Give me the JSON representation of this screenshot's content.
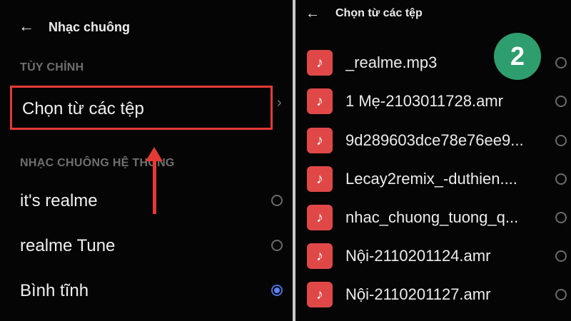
{
  "left": {
    "header": {
      "title": "Nhạc chuông"
    },
    "custom_section": "TÙY CHỈNH",
    "choose_from_files": "Chọn từ các tệp",
    "system_section": "NHẠC CHUÔNG HỆ THỐNG",
    "system_items": [
      {
        "label": "it's realme",
        "selected": false
      },
      {
        "label": "realme Tune",
        "selected": false
      },
      {
        "label": "Bình tĩnh",
        "selected": true
      }
    ]
  },
  "right": {
    "header": {
      "title": "Chọn từ các tệp"
    },
    "files": [
      "_realme.mp3",
      "1 Mẹ-2103011728.amr",
      "9d289603dce78e76ee9...",
      "Lecay2remix_-duthien....",
      "nhac_chuong_tuong_q...",
      "Nội-2110201124.amr",
      "Nội-2110201127.amr"
    ]
  },
  "step_badge": "2",
  "colors": {
    "highlight": "#e53935",
    "badge": "#2f9e6e",
    "file_icon": "#e04848",
    "radio_selected": "#5a82f0"
  },
  "icons": {
    "back": "back-arrow-icon",
    "chevron": "chevron-right-icon",
    "file": "music-note-icon"
  }
}
